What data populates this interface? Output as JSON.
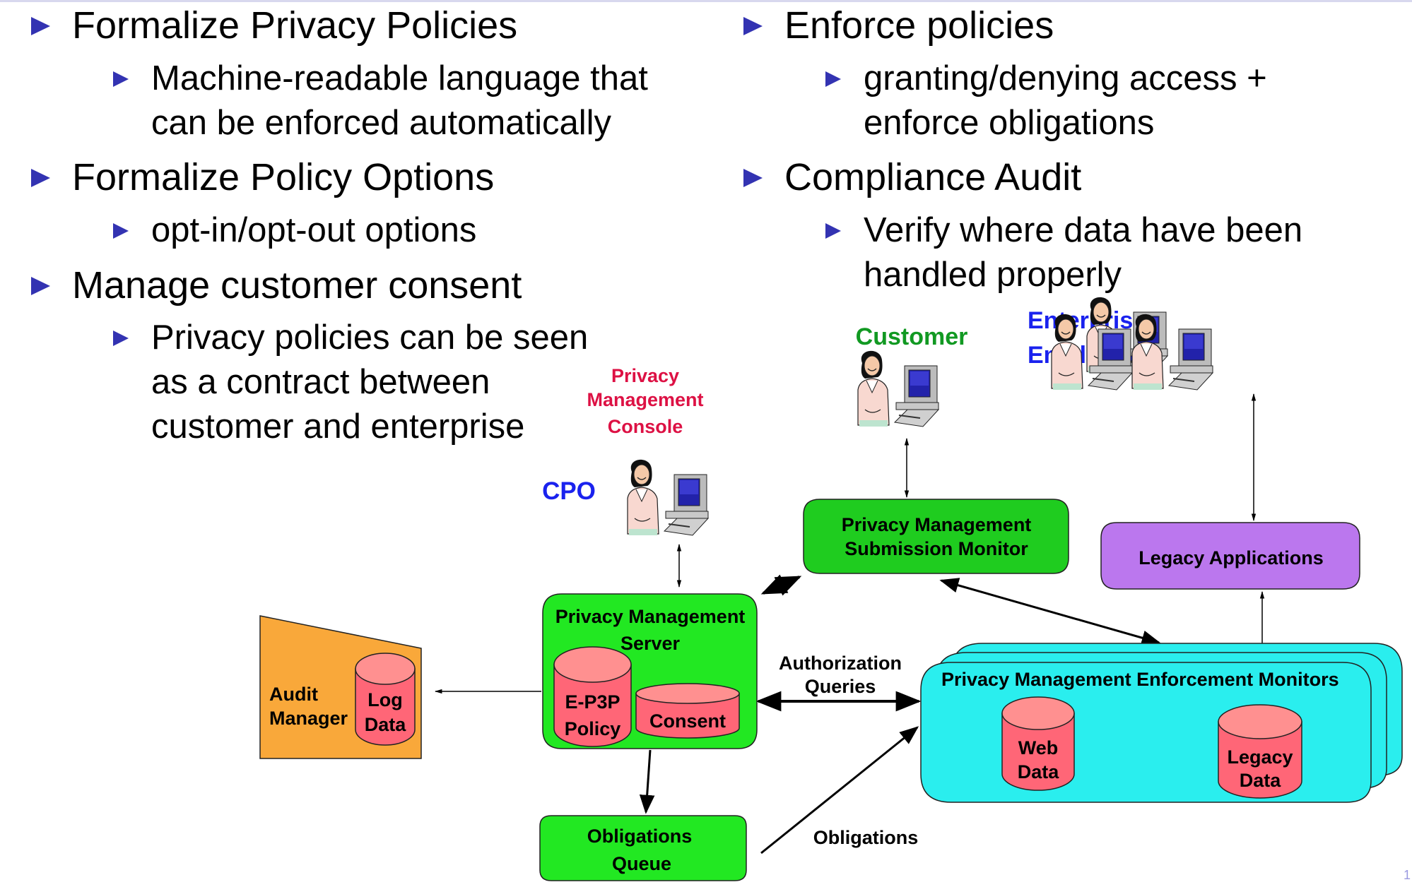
{
  "slide": {
    "page_number": "1",
    "left_column": [
      {
        "title": "Formalize Privacy Policies",
        "sub": [
          "Machine-readable language that",
          "can be enforced automatically"
        ]
      },
      {
        "title": "Formalize Policy Options",
        "sub": [
          "opt-in/opt-out options"
        ]
      },
      {
        "title": "Manage customer consent",
        "sub": [
          "Privacy policies can be seen",
          "as a contract between",
          "customer and enterprise"
        ]
      }
    ],
    "right_column": [
      {
        "title": "Enforce policies",
        "sub": [
          "granting/denying access +",
          "enforce obligations"
        ]
      },
      {
        "title": "Compliance Audit",
        "sub": [
          "Verify where data have been",
          "handled properly"
        ]
      }
    ]
  },
  "diagram": {
    "actors": {
      "console_label": [
        "Privacy",
        "Management",
        "Console"
      ],
      "cpo": "CPO",
      "customer": "Customer",
      "employees": [
        "Enterprise",
        "Employees"
      ]
    },
    "nodes": {
      "submission_monitor": [
        "Privacy Management",
        "Submission Monitor"
      ],
      "legacy_apps": "Legacy Applications",
      "server": [
        "Privacy Management",
        "Server"
      ],
      "epolicy": [
        "E-P3P",
        "Policy"
      ],
      "consent": "Consent",
      "audit_manager": [
        "Audit",
        "Manager"
      ],
      "log_data": [
        "Log",
        "Data"
      ],
      "obligations_queue": [
        "Obligations",
        "Queue"
      ],
      "enforcement": "Privacy Management Enforcement Monitors",
      "web_data": [
        "Web",
        "Data"
      ],
      "legacy_data": [
        "Legacy",
        "Data"
      ]
    },
    "edge_labels": {
      "authorization": [
        "Authorization",
        "Queries"
      ],
      "obligations": "Obligations"
    },
    "colors": {
      "bullet": "#3333b2",
      "green_box": "#22dd22",
      "submission_green": "#1fcc1f",
      "purple_box": "#bb77ee",
      "cyan_box": "#2aeeee",
      "orange_box": "#f9a83a",
      "cyl_body": "#ff6677",
      "cyl_top": "#ff9090",
      "console_red": "#dd1144",
      "cpo_blue": "#1a22ee",
      "customer_green": "#119922",
      "employees_blue": "#1a22ee"
    }
  }
}
